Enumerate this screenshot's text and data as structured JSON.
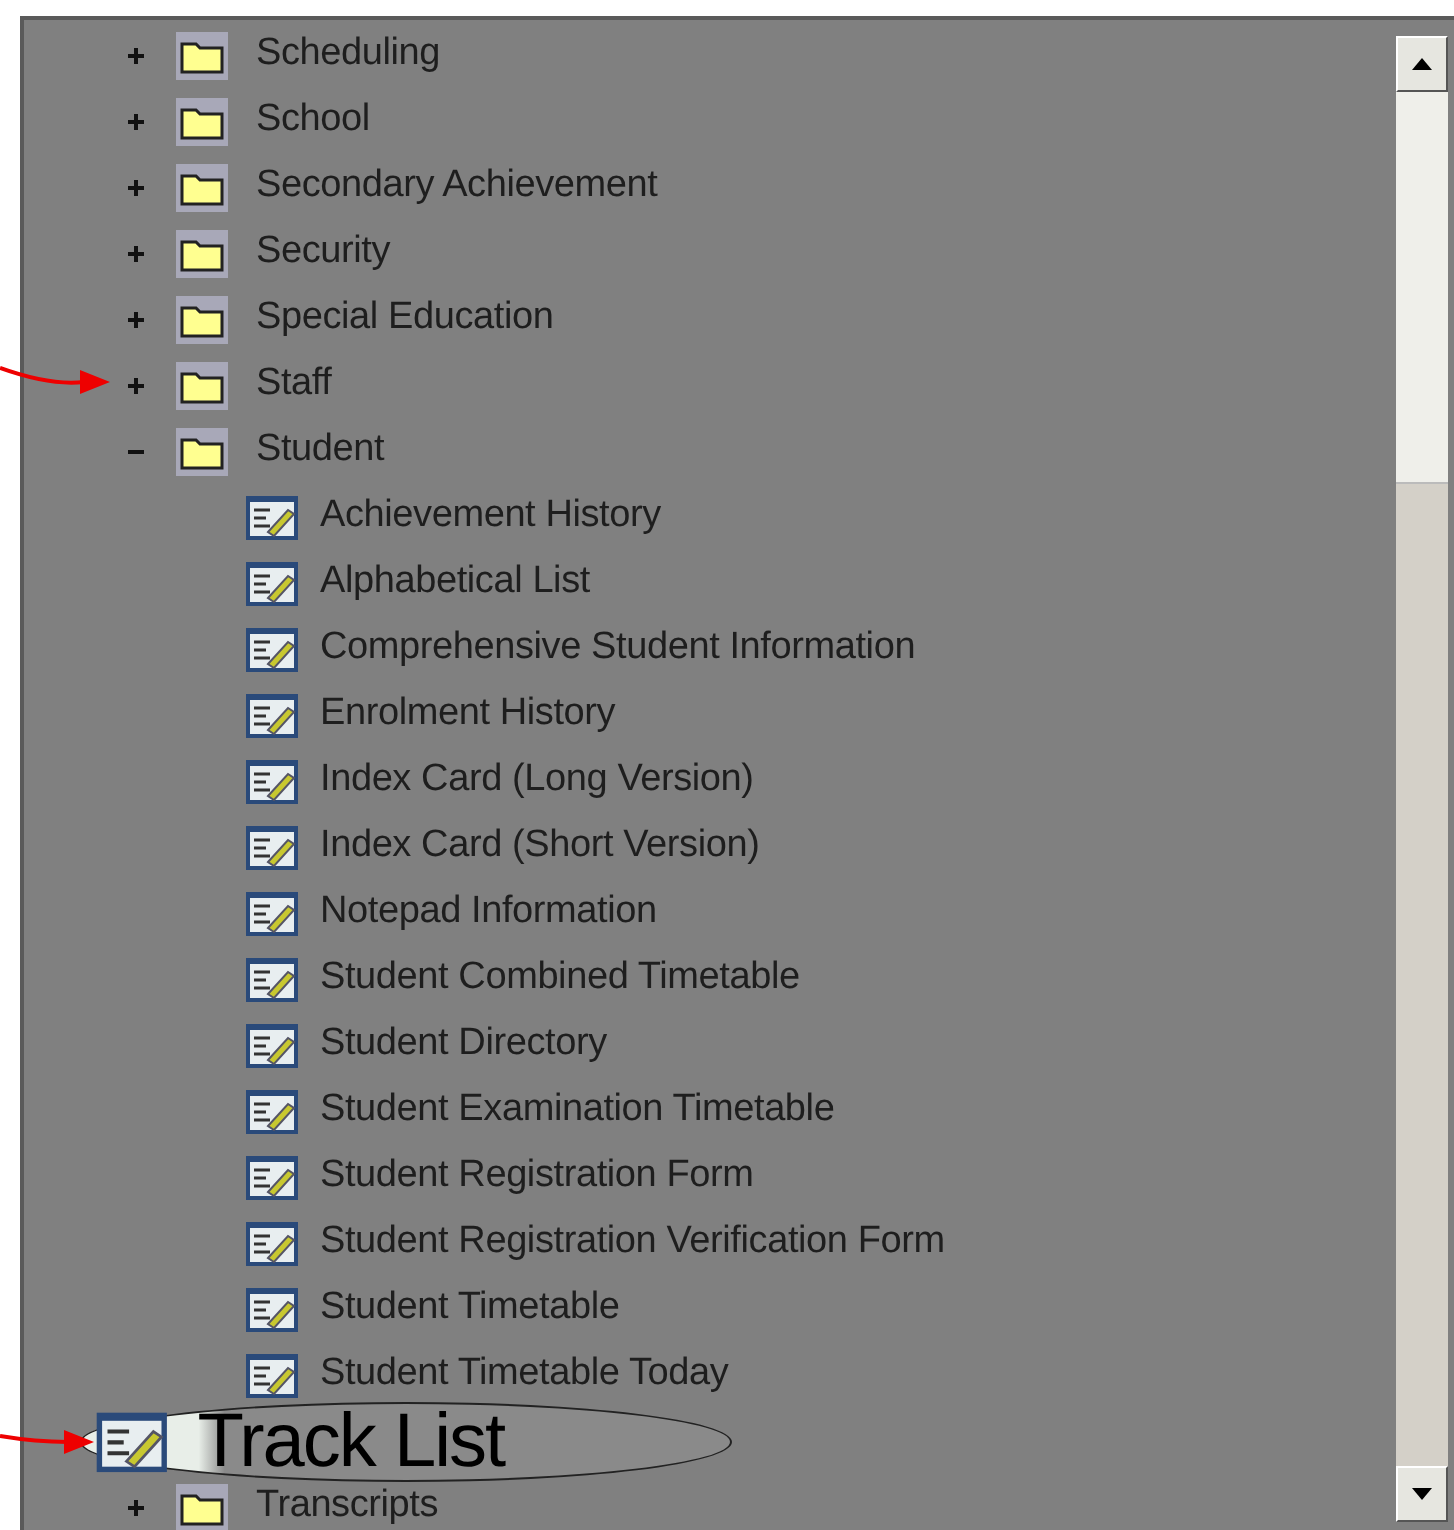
{
  "tree": {
    "items": [
      {
        "label": "Scheduling",
        "expanded": false
      },
      {
        "label": "School",
        "expanded": false
      },
      {
        "label": "Secondary Achievement",
        "expanded": false
      },
      {
        "label": "Security",
        "expanded": false
      },
      {
        "label": "Special Education",
        "expanded": false
      },
      {
        "label": "Staff",
        "expanded": false
      },
      {
        "label": "Student",
        "expanded": true,
        "children": [
          {
            "label": "Achievement History"
          },
          {
            "label": "Alphabetical List"
          },
          {
            "label": "Comprehensive Student Information"
          },
          {
            "label": "Enrolment History"
          },
          {
            "label": "Index Card (Long Version)"
          },
          {
            "label": "Index Card (Short Version)"
          },
          {
            "label": "Notepad Information"
          },
          {
            "label": "Student Combined Timetable"
          },
          {
            "label": "Student Directory"
          },
          {
            "label": "Student Examination Timetable"
          },
          {
            "label": "Student Registration Form"
          },
          {
            "label": "Student Registration Verification Form"
          },
          {
            "label": "Student Timetable"
          },
          {
            "label": "Student Timetable Today"
          }
        ]
      },
      {
        "label": "Transcripts",
        "expanded": false
      }
    ]
  },
  "callout": {
    "label": "Track List"
  }
}
